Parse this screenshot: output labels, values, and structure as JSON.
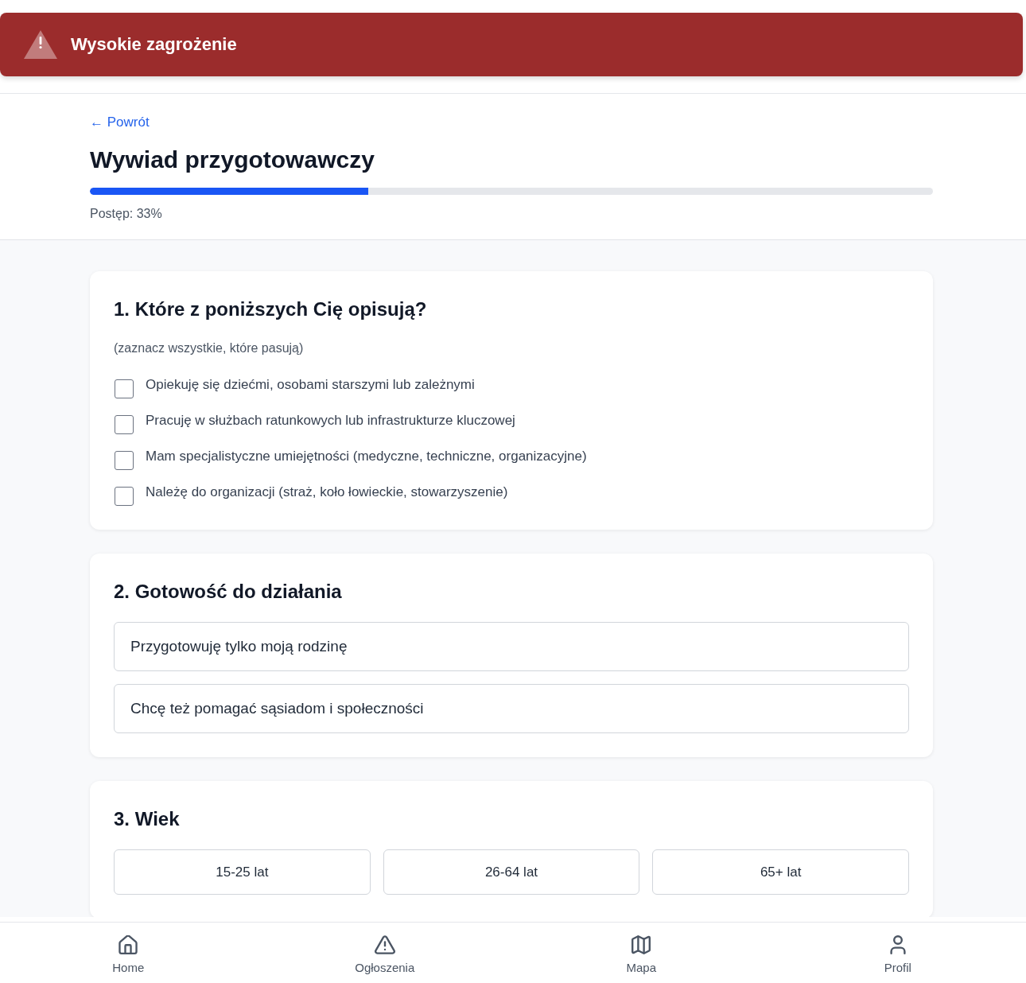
{
  "banner": {
    "title": "Wysokie zagrożenie"
  },
  "header": {
    "back_link": "← Powrót",
    "title": "Wywiad przygotowawczy",
    "progress": {
      "level": 0.33,
      "label": "Postęp: 33%"
    }
  },
  "questions": [
    {
      "kind": "checkbox",
      "title": "1. Które z poniższych Cię opisują?",
      "hint": "(zaznacz wszystkie, które pasują)",
      "options": [
        {
          "label": "Opiekuję się dziećmi, osobami starszymi lub zależnymi",
          "checked": false
        },
        {
          "label": "Pracuję w służbach ratunkowych lub infrastrukturze kluczowej",
          "checked": false
        },
        {
          "label": "Mam specjalistyczne umiejętności (medyczne, techniczne, organizacyjne)",
          "checked": false
        },
        {
          "label": "Należę do organizacji (straż, koło łowieckie, stowarzyszenie)",
          "checked": false
        }
      ]
    },
    {
      "kind": "choice",
      "title": "2. Gotowość do działania",
      "options": [
        {
          "label": "Przygotowuję tylko moją rodzinę",
          "selected": false
        },
        {
          "label": "Chcę też pomagać sąsiadom i społeczności",
          "selected": false
        }
      ]
    },
    {
      "kind": "grid",
      "title": "3. Wiek",
      "options": [
        {
          "label": "15-25 lat",
          "selected": false
        },
        {
          "label": "26-64 lat",
          "selected": false
        },
        {
          "label": "65+ lat",
          "selected": false
        }
      ]
    }
  ],
  "nav": [
    {
      "label": "Home",
      "selected": false
    },
    {
      "label": "Ogłoszenia",
      "selected": false
    },
    {
      "label": "Mapa",
      "selected": false
    },
    {
      "label": "Profil",
      "selected": false
    }
  ]
}
